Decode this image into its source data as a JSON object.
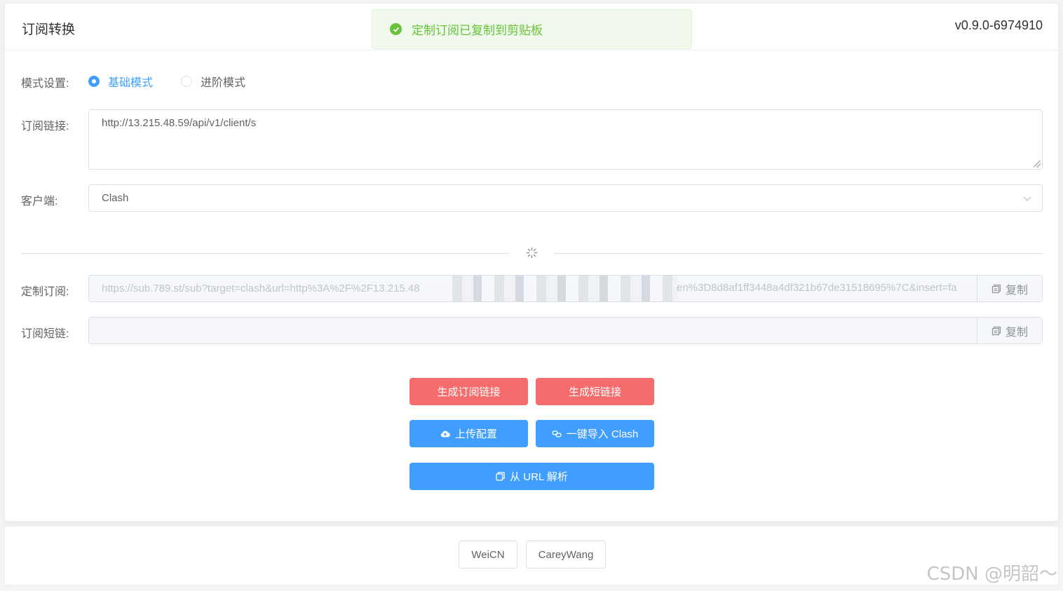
{
  "header": {
    "title": "订阅转换",
    "version": "v0.9.0-6974910"
  },
  "toast": {
    "message": "定制订阅已复制到剪贴板",
    "color": "#67c23a"
  },
  "form": {
    "mode_label": "模式设置:",
    "mode_options": [
      {
        "label": "基础模式",
        "checked": true
      },
      {
        "label": "进阶模式",
        "checked": false
      }
    ],
    "sub_url_label": "订阅链接:",
    "sub_url_value": "http://13.215.48.59/api/v1/client/s",
    "client_label": "客户端:",
    "client_value": "Clash",
    "custom_sub_label": "定制订阅:",
    "custom_sub_value_start": "https://sub.789.st/sub?target=clash&url=http%3A%2F%2F13.215.48",
    "custom_sub_value_end": "en%3D8d8af1ff3448a4df321b67de31518695%7C&insert=fa",
    "short_link_label": "订阅短链:",
    "short_link_value": "",
    "copy_label": "复制"
  },
  "buttons": {
    "generate_sub": "生成订阅链接",
    "generate_short": "生成短链接",
    "upload_config": "上传配置",
    "import_clash": "一键导入 Clash",
    "parse_url": "从 URL 解析"
  },
  "footer": {
    "links": [
      "WeiCN",
      "CareyWang"
    ]
  },
  "watermark": "CSDN @明韶～",
  "colors": {
    "primary": "#409eff",
    "danger": "#f56c6c",
    "success": "#67c23a"
  }
}
